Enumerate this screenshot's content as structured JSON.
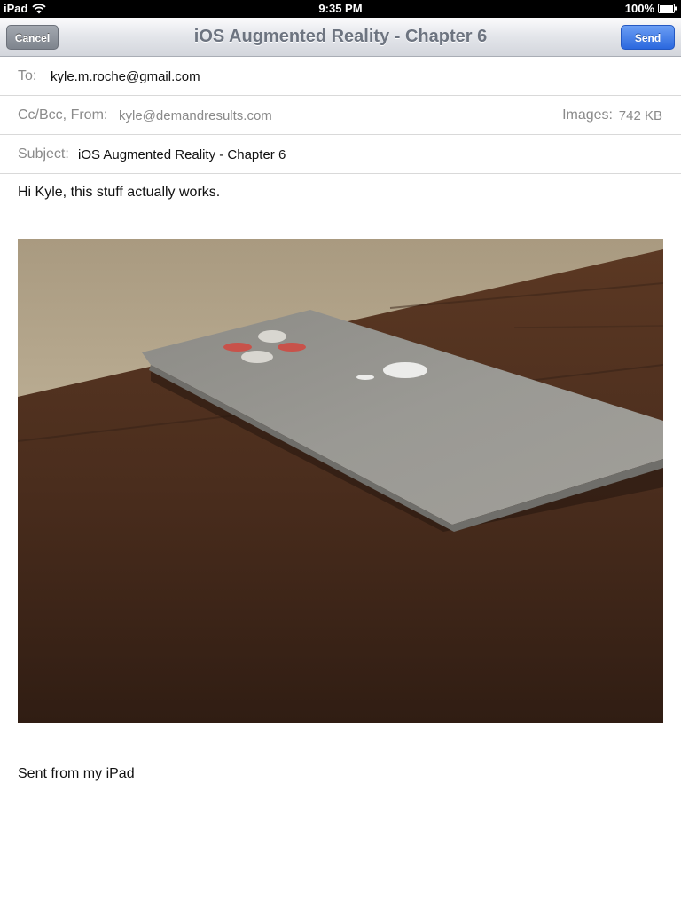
{
  "status_bar": {
    "device": "iPad",
    "time": "9:35 PM",
    "battery": "100%"
  },
  "nav": {
    "title": "iOS Augmented Reality - Chapter 6",
    "cancel_label": "Cancel",
    "send_label": "Send"
  },
  "fields": {
    "to_label": "To:",
    "to_value": "kyle.m.roche@gmail.com",
    "ccbcc_label": "Cc/Bcc, From:",
    "from_value": "kyle@demandresults.com",
    "images_label": "Images:",
    "images_value": "742 KB",
    "subject_label": "Subject:",
    "subject_value": "iOS Augmented Reality - Chapter 6"
  },
  "body": {
    "message": "Hi Kyle, this stuff actually works.",
    "signature": "Sent from my iPad"
  },
  "colors": {
    "send_button": "#2b68de",
    "cancel_button": "#7e848d",
    "label_gray": "#8a8a8a"
  },
  "icons": [
    "wifi-icon",
    "battery-icon"
  ]
}
